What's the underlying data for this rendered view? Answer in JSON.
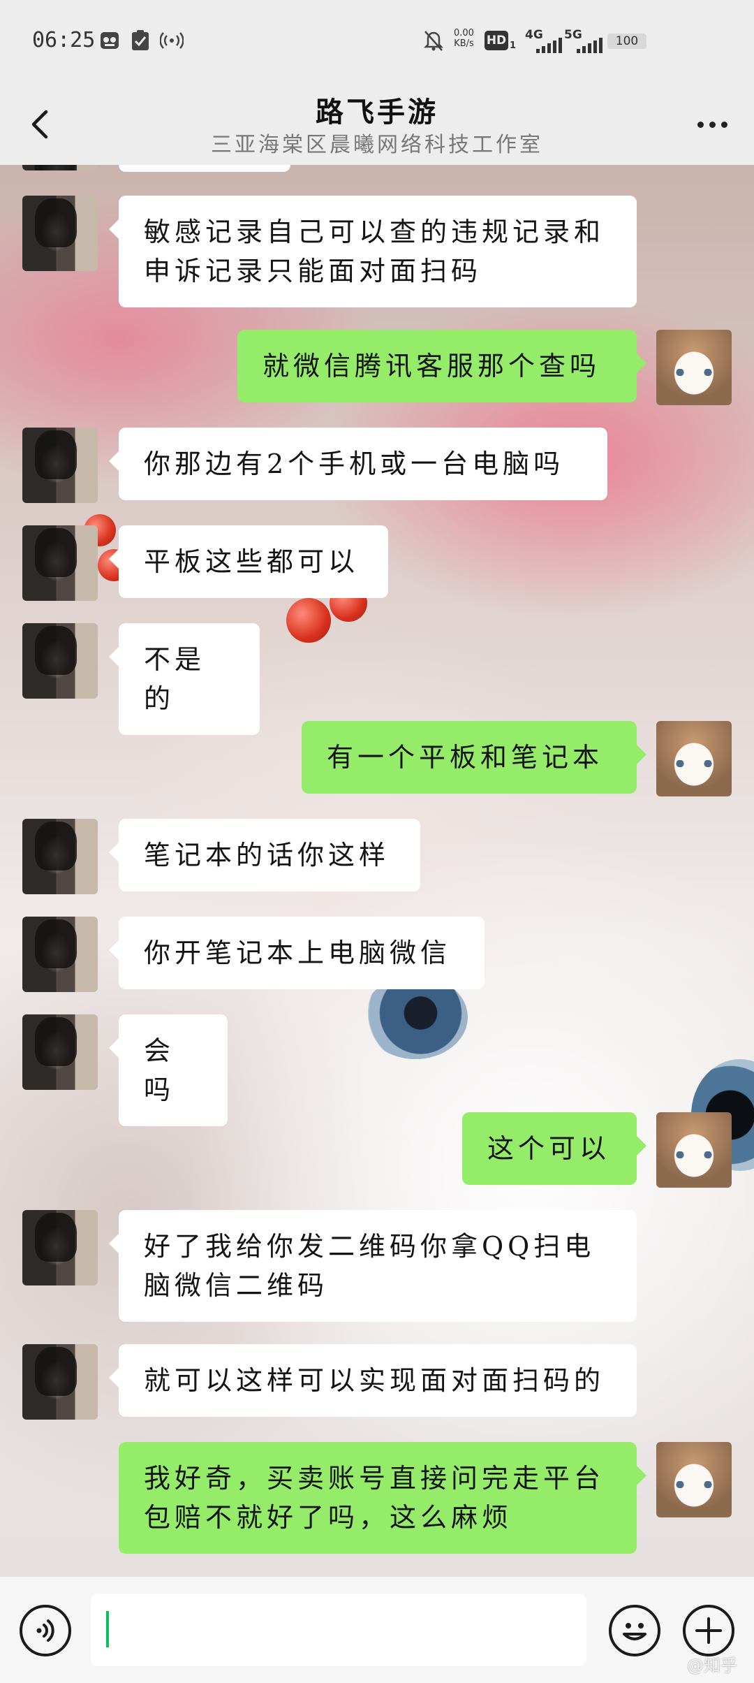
{
  "status_bar": {
    "time": "06:25",
    "net_speed_value": "0.00",
    "net_speed_unit": "KB/s",
    "hd_label": "HD",
    "hd_sub": "1",
    "net_4g": "4G",
    "net_5g": "5G",
    "battery": "100"
  },
  "header": {
    "title": "路飞手游",
    "subtitle": "三亚海棠区晨曦网络科技工作室"
  },
  "messages": [
    {
      "from": "contact",
      "text": "敏感记录自己可以查的违规记录和申诉记录只能面对面扫码"
    },
    {
      "from": "self",
      "text": "就微信腾讯客服那个查吗"
    },
    {
      "from": "contact",
      "text": "你那边有2个手机或一台电脑吗"
    },
    {
      "from": "contact",
      "text": "平板这些都可以"
    },
    {
      "from": "contact",
      "text": "不是的"
    },
    {
      "from": "self",
      "text": "有一个平板和笔记本"
    },
    {
      "from": "contact",
      "text": "笔记本的话你这样"
    },
    {
      "from": "contact",
      "text": "你开笔记本上电脑微信"
    },
    {
      "from": "contact",
      "text": "会吗"
    },
    {
      "from": "self",
      "text": "这个可以"
    },
    {
      "from": "contact",
      "text": "好了我给你发二维码你拿QQ扫电脑微信二维码"
    },
    {
      "from": "contact",
      "text": "就可以这样可以实现面对面扫码的"
    },
    {
      "from": "self",
      "text": "我好奇，买卖账号直接问完走平台包赔不就好了吗，这么麻烦"
    }
  ],
  "input_bar": {
    "text": "",
    "watermark": "@知乎"
  },
  "colors": {
    "bubble_out": "#95ec69",
    "bubble_in": "#ffffff",
    "bar_bg": "#ededed",
    "caret": "#07c160"
  }
}
